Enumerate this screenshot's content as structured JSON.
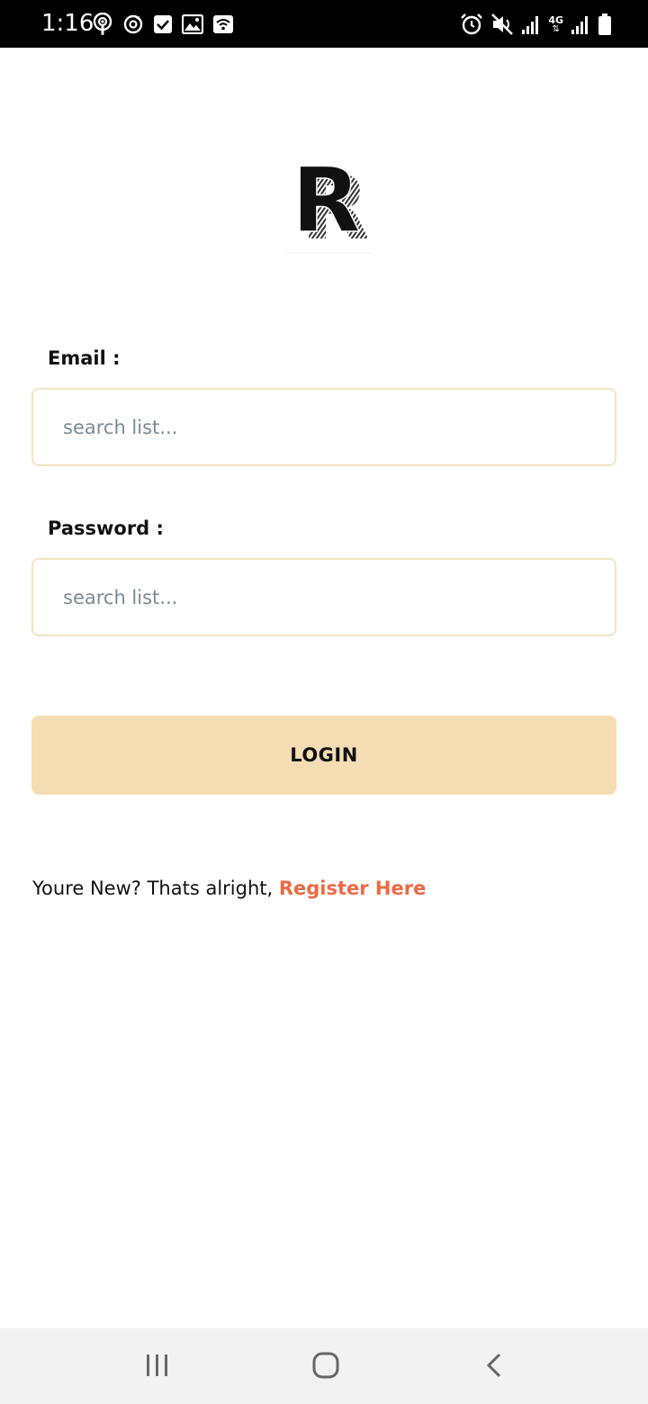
{
  "status_bar": {
    "time": "1:16",
    "network_label": "4G"
  },
  "logo": {
    "letter": "R"
  },
  "form": {
    "email_label": "Email :",
    "email_placeholder": "search list...",
    "password_label": "Password :",
    "password_placeholder": "search list...",
    "login_label": "LOGIN"
  },
  "register": {
    "prompt": "Youre New? Thats alright, ",
    "link_label": "Register Here"
  },
  "colors": {
    "accent": "#f4ddb3",
    "input_border": "#f1e3bf",
    "link": "#ed6a45",
    "status_bar": "#000000",
    "nav_bar": "#f2f2f2"
  },
  "nav_icons": [
    "recents-icon",
    "home-icon",
    "back-icon"
  ]
}
